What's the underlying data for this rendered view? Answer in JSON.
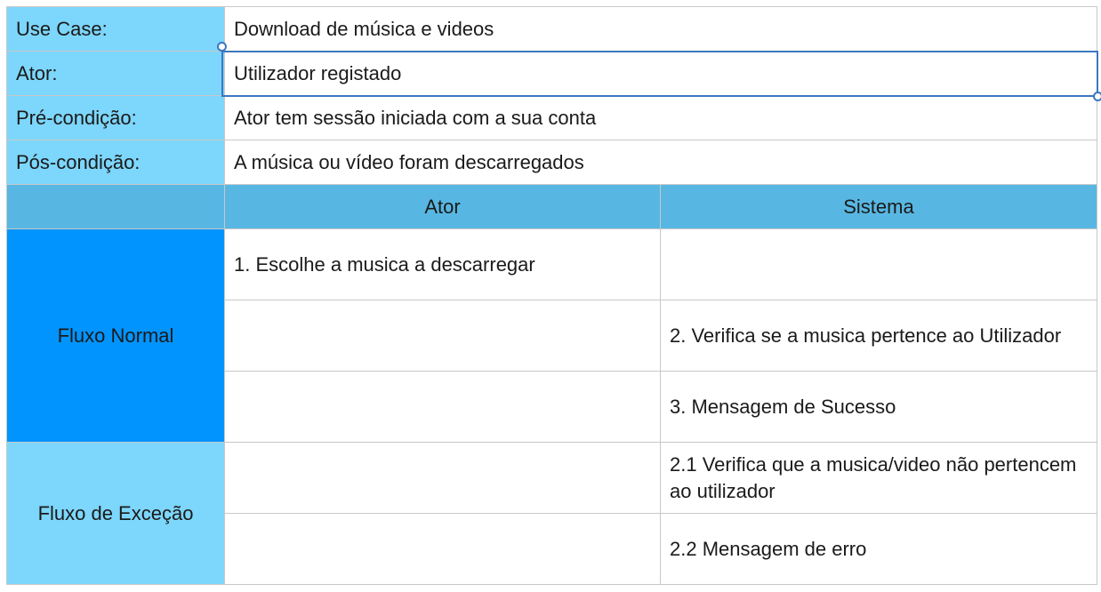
{
  "use_case": {
    "label": "Use Case:",
    "value": "Download de música e videos"
  },
  "actor": {
    "label": "Ator:",
    "value": "Utilizador registado"
  },
  "precondition": {
    "label": "Pré-condição:",
    "value": "Ator tem sessão iniciada com a sua conta"
  },
  "postcondition": {
    "label": "Pós-condição:",
    "value": "A música ou vídeo foram descarregados"
  },
  "flow_header": {
    "actor": "Ator",
    "system": "Sistema"
  },
  "normal_flow": {
    "label": "Fluxo Normal",
    "steps": [
      {
        "actor": "1. Escolhe a musica a descarregar",
        "system": ""
      },
      {
        "actor": "",
        "system": "2. Verifica se a musica pertence ao Utilizador"
      },
      {
        "actor": "",
        "system": "3. Mensagem de Sucesso"
      }
    ]
  },
  "exception_flow": {
    "label": "Fluxo de Exceção",
    "steps": [
      {
        "actor": "",
        "system": "2.1 Verifica que a musica/video não pertencem ao utilizador"
      },
      {
        "actor": "",
        "system": "2.2 Mensagem de erro"
      }
    ]
  },
  "colors": {
    "label_light": "#7dd6fb",
    "label_header": "#58b7e2",
    "label_normal_flow": "#0294fe",
    "selection": "#3a78c0"
  }
}
